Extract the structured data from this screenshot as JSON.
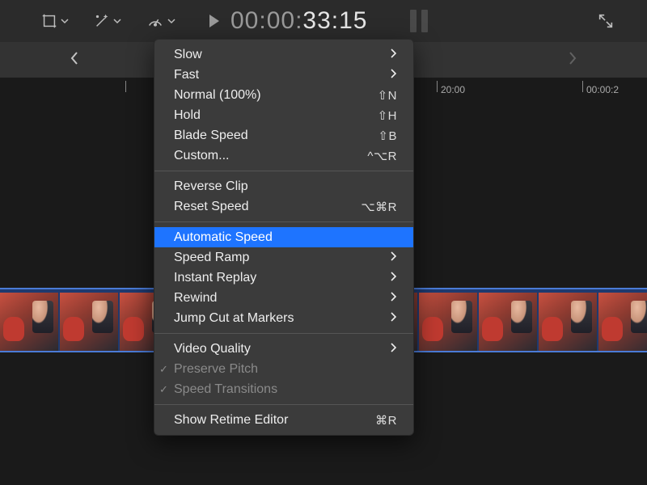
{
  "toolbar": {
    "timecode_dim": "00:00:",
    "timecode_bright": "33:15"
  },
  "ruler": {
    "ticks": [
      {
        "pos": 155,
        "label": ""
      },
      {
        "pos": 540,
        "label": "20:00"
      },
      {
        "pos": 720,
        "label": "00:00:2"
      }
    ]
  },
  "menu": {
    "groups": [
      [
        {
          "label": "Slow",
          "submenu": true
        },
        {
          "label": "Fast",
          "submenu": true
        },
        {
          "label": "Normal (100%)",
          "shortcut": "⇧N"
        },
        {
          "label": "Hold",
          "shortcut": "⇧H"
        },
        {
          "label": "Blade Speed",
          "shortcut": "⇧B"
        },
        {
          "label": "Custom...",
          "shortcut": "^⌥R"
        }
      ],
      [
        {
          "label": "Reverse Clip"
        },
        {
          "label": "Reset Speed",
          "shortcut": "⌥⌘R"
        }
      ],
      [
        {
          "label": "Automatic Speed",
          "selected": true
        },
        {
          "label": "Speed Ramp",
          "submenu": true
        },
        {
          "label": "Instant Replay",
          "submenu": true
        },
        {
          "label": "Rewind",
          "submenu": true
        },
        {
          "label": "Jump Cut at Markers",
          "submenu": true
        }
      ],
      [
        {
          "label": "Video Quality",
          "submenu": true
        },
        {
          "label": "Preserve Pitch",
          "disabled": true,
          "checked": true
        },
        {
          "label": "Speed Transitions",
          "disabled": true,
          "checked": true
        }
      ],
      [
        {
          "label": "Show Retime Editor",
          "shortcut": "⌘R"
        }
      ]
    ]
  }
}
